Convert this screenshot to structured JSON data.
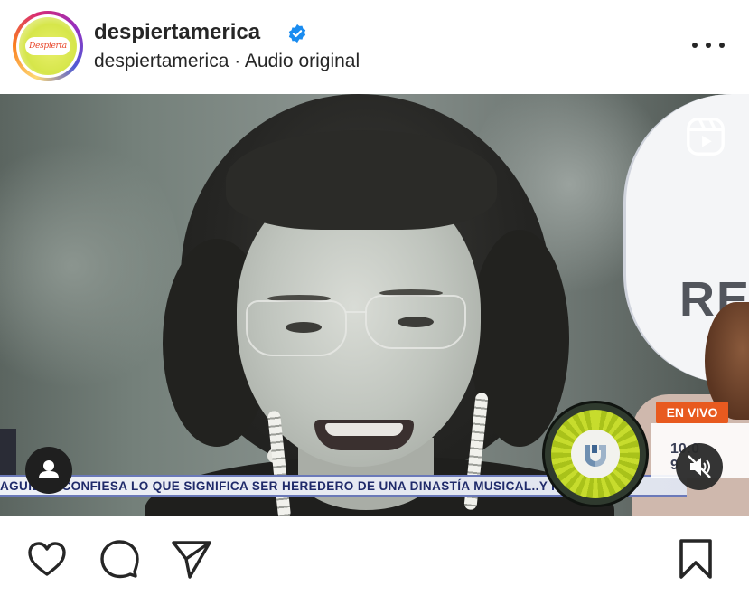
{
  "header": {
    "username": "despiertamerica",
    "avatar_text": "Despierta",
    "subline": "despiertamerica · Audio original",
    "verified": true
  },
  "media": {
    "studio_text": "RE",
    "ticker_text": "AGUILAR CONFIESA LO QUE SIGNIFICA SER HEREDERO DE UNA DINASTÍA MUSICAL..Y R",
    "live_badge": "EN VIVO",
    "time_partial": "10:0",
    "temp_partial": "9",
    "icons": {
      "reels": "reels-icon",
      "tag": "user-tag-icon",
      "mute": "muted-speaker-icon",
      "network_logo": "univision-logo"
    },
    "colors": {
      "live_badge": "#e85a1f",
      "ticker_text": "#1f2a6a"
    }
  },
  "actions": {
    "like": "heart-icon",
    "comment": "comment-icon",
    "share": "send-icon",
    "save": "bookmark-icon"
  }
}
